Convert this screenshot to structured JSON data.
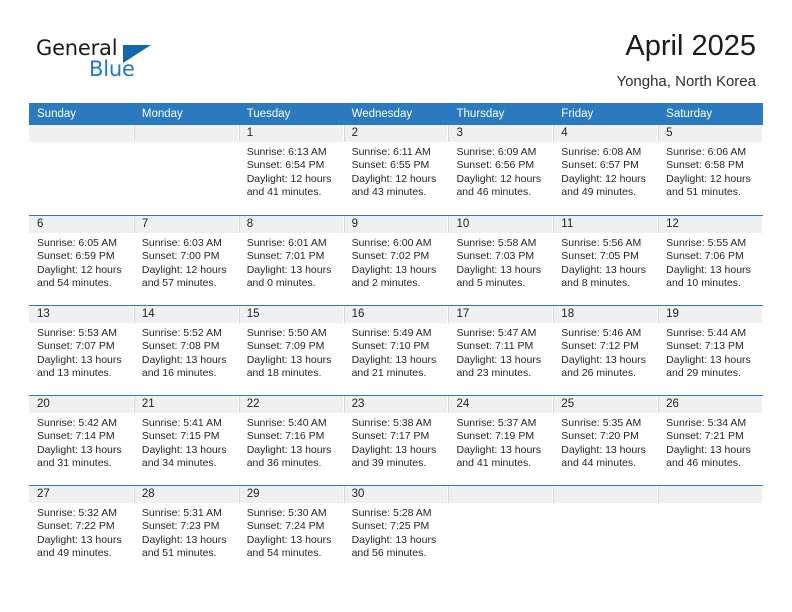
{
  "brand": {
    "name_part1": "General",
    "name_part2": "Blue",
    "logo_icon": "triangle-logo-icon",
    "accent_color": "#2b79bf"
  },
  "header": {
    "title": "April 2025",
    "subtitle": "Yongha, North Korea"
  },
  "calendar": {
    "weekdays": [
      "Sunday",
      "Monday",
      "Tuesday",
      "Wednesday",
      "Thursday",
      "Friday",
      "Saturday"
    ],
    "weeks": [
      [
        {
          "day": "",
          "sunrise": "",
          "sunset": "",
          "daylight_line1": "",
          "daylight_line2": "",
          "empty": true
        },
        {
          "day": "",
          "sunrise": "",
          "sunset": "",
          "daylight_line1": "",
          "daylight_line2": "",
          "empty": true
        },
        {
          "day": "1",
          "sunrise": "Sunrise: 6:13 AM",
          "sunset": "Sunset: 6:54 PM",
          "daylight_line1": "Daylight: 12 hours",
          "daylight_line2": "and 41 minutes."
        },
        {
          "day": "2",
          "sunrise": "Sunrise: 6:11 AM",
          "sunset": "Sunset: 6:55 PM",
          "daylight_line1": "Daylight: 12 hours",
          "daylight_line2": "and 43 minutes."
        },
        {
          "day": "3",
          "sunrise": "Sunrise: 6:09 AM",
          "sunset": "Sunset: 6:56 PM",
          "daylight_line1": "Daylight: 12 hours",
          "daylight_line2": "and 46 minutes."
        },
        {
          "day": "4",
          "sunrise": "Sunrise: 6:08 AM",
          "sunset": "Sunset: 6:57 PM",
          "daylight_line1": "Daylight: 12 hours",
          "daylight_line2": "and 49 minutes."
        },
        {
          "day": "5",
          "sunrise": "Sunrise: 6:06 AM",
          "sunset": "Sunset: 6:58 PM",
          "daylight_line1": "Daylight: 12 hours",
          "daylight_line2": "and 51 minutes."
        }
      ],
      [
        {
          "day": "6",
          "sunrise": "Sunrise: 6:05 AM",
          "sunset": "Sunset: 6:59 PM",
          "daylight_line1": "Daylight: 12 hours",
          "daylight_line2": "and 54 minutes."
        },
        {
          "day": "7",
          "sunrise": "Sunrise: 6:03 AM",
          "sunset": "Sunset: 7:00 PM",
          "daylight_line1": "Daylight: 12 hours",
          "daylight_line2": "and 57 minutes."
        },
        {
          "day": "8",
          "sunrise": "Sunrise: 6:01 AM",
          "sunset": "Sunset: 7:01 PM",
          "daylight_line1": "Daylight: 13 hours",
          "daylight_line2": "and 0 minutes."
        },
        {
          "day": "9",
          "sunrise": "Sunrise: 6:00 AM",
          "sunset": "Sunset: 7:02 PM",
          "daylight_line1": "Daylight: 13 hours",
          "daylight_line2": "and 2 minutes."
        },
        {
          "day": "10",
          "sunrise": "Sunrise: 5:58 AM",
          "sunset": "Sunset: 7:03 PM",
          "daylight_line1": "Daylight: 13 hours",
          "daylight_line2": "and 5 minutes."
        },
        {
          "day": "11",
          "sunrise": "Sunrise: 5:56 AM",
          "sunset": "Sunset: 7:05 PM",
          "daylight_line1": "Daylight: 13 hours",
          "daylight_line2": "and 8 minutes."
        },
        {
          "day": "12",
          "sunrise": "Sunrise: 5:55 AM",
          "sunset": "Sunset: 7:06 PM",
          "daylight_line1": "Daylight: 13 hours",
          "daylight_line2": "and 10 minutes."
        }
      ],
      [
        {
          "day": "13",
          "sunrise": "Sunrise: 5:53 AM",
          "sunset": "Sunset: 7:07 PM",
          "daylight_line1": "Daylight: 13 hours",
          "daylight_line2": "and 13 minutes."
        },
        {
          "day": "14",
          "sunrise": "Sunrise: 5:52 AM",
          "sunset": "Sunset: 7:08 PM",
          "daylight_line1": "Daylight: 13 hours",
          "daylight_line2": "and 16 minutes."
        },
        {
          "day": "15",
          "sunrise": "Sunrise: 5:50 AM",
          "sunset": "Sunset: 7:09 PM",
          "daylight_line1": "Daylight: 13 hours",
          "daylight_line2": "and 18 minutes."
        },
        {
          "day": "16",
          "sunrise": "Sunrise: 5:49 AM",
          "sunset": "Sunset: 7:10 PM",
          "daylight_line1": "Daylight: 13 hours",
          "daylight_line2": "and 21 minutes."
        },
        {
          "day": "17",
          "sunrise": "Sunrise: 5:47 AM",
          "sunset": "Sunset: 7:11 PM",
          "daylight_line1": "Daylight: 13 hours",
          "daylight_line2": "and 23 minutes."
        },
        {
          "day": "18",
          "sunrise": "Sunrise: 5:46 AM",
          "sunset": "Sunset: 7:12 PM",
          "daylight_line1": "Daylight: 13 hours",
          "daylight_line2": "and 26 minutes."
        },
        {
          "day": "19",
          "sunrise": "Sunrise: 5:44 AM",
          "sunset": "Sunset: 7:13 PM",
          "daylight_line1": "Daylight: 13 hours",
          "daylight_line2": "and 29 minutes."
        }
      ],
      [
        {
          "day": "20",
          "sunrise": "Sunrise: 5:42 AM",
          "sunset": "Sunset: 7:14 PM",
          "daylight_line1": "Daylight: 13 hours",
          "daylight_line2": "and 31 minutes."
        },
        {
          "day": "21",
          "sunrise": "Sunrise: 5:41 AM",
          "sunset": "Sunset: 7:15 PM",
          "daylight_line1": "Daylight: 13 hours",
          "daylight_line2": "and 34 minutes."
        },
        {
          "day": "22",
          "sunrise": "Sunrise: 5:40 AM",
          "sunset": "Sunset: 7:16 PM",
          "daylight_line1": "Daylight: 13 hours",
          "daylight_line2": "and 36 minutes."
        },
        {
          "day": "23",
          "sunrise": "Sunrise: 5:38 AM",
          "sunset": "Sunset: 7:17 PM",
          "daylight_line1": "Daylight: 13 hours",
          "daylight_line2": "and 39 minutes."
        },
        {
          "day": "24",
          "sunrise": "Sunrise: 5:37 AM",
          "sunset": "Sunset: 7:19 PM",
          "daylight_line1": "Daylight: 13 hours",
          "daylight_line2": "and 41 minutes."
        },
        {
          "day": "25",
          "sunrise": "Sunrise: 5:35 AM",
          "sunset": "Sunset: 7:20 PM",
          "daylight_line1": "Daylight: 13 hours",
          "daylight_line2": "and 44 minutes."
        },
        {
          "day": "26",
          "sunrise": "Sunrise: 5:34 AM",
          "sunset": "Sunset: 7:21 PM",
          "daylight_line1": "Daylight: 13 hours",
          "daylight_line2": "and 46 minutes."
        }
      ],
      [
        {
          "day": "27",
          "sunrise": "Sunrise: 5:32 AM",
          "sunset": "Sunset: 7:22 PM",
          "daylight_line1": "Daylight: 13 hours",
          "daylight_line2": "and 49 minutes."
        },
        {
          "day": "28",
          "sunrise": "Sunrise: 5:31 AM",
          "sunset": "Sunset: 7:23 PM",
          "daylight_line1": "Daylight: 13 hours",
          "daylight_line2": "and 51 minutes."
        },
        {
          "day": "29",
          "sunrise": "Sunrise: 5:30 AM",
          "sunset": "Sunset: 7:24 PM",
          "daylight_line1": "Daylight: 13 hours",
          "daylight_line2": "and 54 minutes."
        },
        {
          "day": "30",
          "sunrise": "Sunrise: 5:28 AM",
          "sunset": "Sunset: 7:25 PM",
          "daylight_line1": "Daylight: 13 hours",
          "daylight_line2": "and 56 minutes."
        },
        {
          "day": "",
          "sunrise": "",
          "sunset": "",
          "daylight_line1": "",
          "daylight_line2": "",
          "empty": true
        },
        {
          "day": "",
          "sunrise": "",
          "sunset": "",
          "daylight_line1": "",
          "daylight_line2": "",
          "empty": true
        },
        {
          "day": "",
          "sunrise": "",
          "sunset": "",
          "daylight_line1": "",
          "daylight_line2": "",
          "empty": true
        }
      ]
    ]
  }
}
